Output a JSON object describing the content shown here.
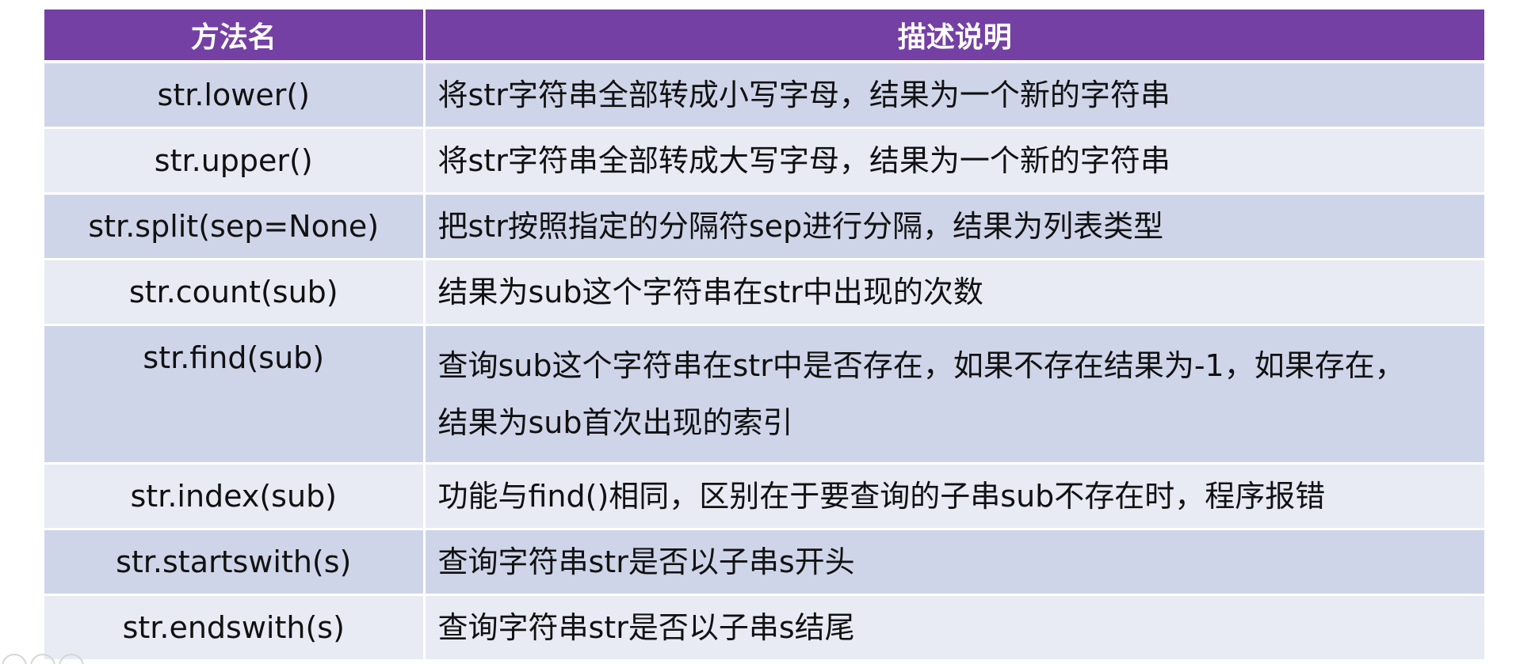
{
  "table": {
    "headers": {
      "method": "方法名",
      "description": "描述说明"
    },
    "rows": [
      {
        "method": "str.lower()",
        "description": "将str字符串全部转成小写字母，结果为一个新的字符串"
      },
      {
        "method": "str.upper()",
        "description": "将str字符串全部转成大写字母，结果为一个新的字符串"
      },
      {
        "method": "str.split(sep=None)",
        "description": "把str按照指定的分隔符sep进行分隔，结果为列表类型"
      },
      {
        "method": "str.count(sub)",
        "description": "结果为sub这个字符串在str中出现的次数"
      },
      {
        "method": "str.find(sub)",
        "description_line1": "查询sub这个字符串在str中是否存在，如果不存在结果为-1，如果存在，",
        "description_line2": "结果为sub首次出现的索引"
      },
      {
        "method": "str.index(sub)",
        "description": "功能与find()相同，区别在于要查询的子串sub不存在时，程序报错"
      },
      {
        "method": "str.startswith(s)",
        "description": "查询字符串str是否以子串s开头"
      },
      {
        "method": "str.endswith(s)",
        "description": "查询字符串str是否以子串s结尾"
      }
    ]
  },
  "colors": {
    "header_bg": "#7440a4",
    "row_odd_bg": "#cfd5e9",
    "row_even_bg": "#e8ebf4"
  }
}
